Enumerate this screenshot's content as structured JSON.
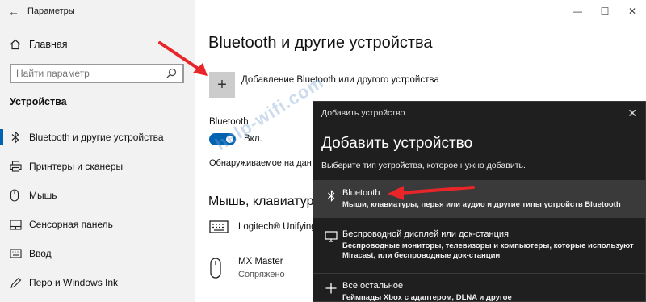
{
  "window": {
    "title": "Параметры",
    "controls": [
      "minimize-icon",
      "maximize-icon",
      "close-icon"
    ]
  },
  "sidebar": {
    "home": "Главная",
    "search_placeholder": "Найти параметр",
    "section": "Устройства",
    "items": [
      {
        "label": "Bluetooth и другие устройства",
        "icon": "bluetooth-icon",
        "active": true
      },
      {
        "label": "Принтеры и сканеры",
        "icon": "printer-icon"
      },
      {
        "label": "Мышь",
        "icon": "mouse-icon"
      },
      {
        "label": "Сенсорная панель",
        "icon": "touchpad-icon"
      },
      {
        "label": "Ввод",
        "icon": "keyboard-icon"
      },
      {
        "label": "Перо и Windows Ink",
        "icon": "pen-icon"
      }
    ]
  },
  "main": {
    "title": "Bluetooth и другие устройства",
    "add_label": "Добавление Bluetooth или другого устройства",
    "bluetooth_label": "Bluetooth",
    "toggle_text": "Вкл.",
    "discoverable": "Обнаруживаемое на дан",
    "group_title": "Мышь, клавиатура",
    "devices": [
      {
        "name": "Logitech® Unifying",
        "status": "",
        "icon": "keyboard-icon"
      },
      {
        "name": "MX Master",
        "status": "Сопряжено",
        "icon": "mouse-icon"
      }
    ]
  },
  "watermark": "help-wifi.com",
  "dialog": {
    "title": "Добавить устройство",
    "heading": "Добавить устройство",
    "subtitle": "Выберите тип устройства, которое нужно добавить.",
    "options": [
      {
        "title": "Bluetooth",
        "desc": "Мыши, клавиатуры, перья или аудио и другие типы устройств Bluetooth",
        "icon": "bluetooth-icon",
        "selected": true
      },
      {
        "title": "Беспроводной дисплей или док-станция",
        "desc": "Беспроводные мониторы, телевизоры и компьютеры, которые используют Miracast, или беспроводные док-станции",
        "icon": "display-icon"
      },
      {
        "title": "Все остальное",
        "desc": "Геймпады Xbox с адаптером, DLNA и другое",
        "icon": "plus-icon"
      }
    ]
  },
  "colors": {
    "accent": "#0063b1",
    "annotation_arrow": "#e8262a",
    "dialog_bg": "#1f1f1f",
    "sidebar_bg": "#f2f2f2"
  }
}
